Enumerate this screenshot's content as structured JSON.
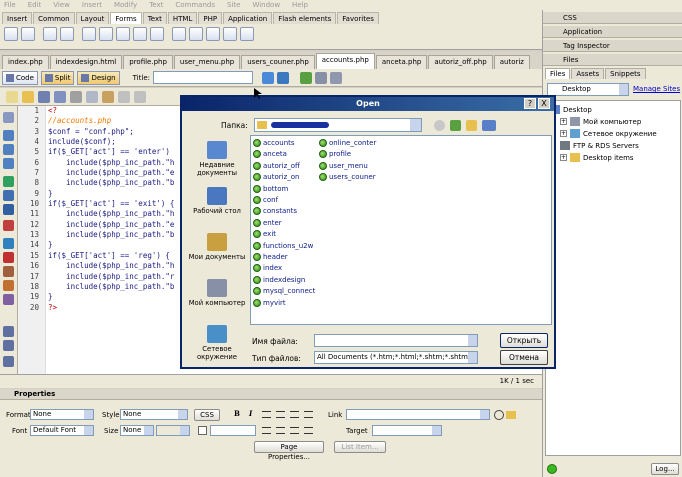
{
  "menubar": [
    "File",
    "Edit",
    "View",
    "Insert",
    "Modify",
    "Text",
    "Commands",
    "Site",
    "Window",
    "Help"
  ],
  "insert_tabs": [
    "Insert",
    "Common",
    "Layout",
    "Forms",
    "Text",
    "HTML",
    "PHP",
    "Application",
    "Flash elements",
    "Favorites"
  ],
  "insert_active": "Forms",
  "doc_tabs": [
    "index.php",
    "indexdesign.html",
    "profile.php",
    "user_menu.php",
    "users_couner.php",
    "accounts.php",
    "anceta.php",
    "autoriz_off.php",
    "autoriz"
  ],
  "doc_active": "accounts.php",
  "doc_toolbar": {
    "code": "Code",
    "split": "Split",
    "design": "Design",
    "title_label": "Title:"
  },
  "code": {
    "line_numbers": [
      "1",
      "2",
      "3",
      "4",
      "5",
      "6",
      "7",
      "8",
      "9",
      "10",
      "11",
      "12",
      "13",
      "14",
      "15",
      "16",
      "17",
      "18",
      "19",
      "20"
    ],
    "lines": [
      "<?",
      "//accounts.php",
      "$conf = \"conf.php\";",
      "include($conf);",
      "if($_GET['act'] == 'enter')",
      "    include($php_inc_path.\"h",
      "    include($php_inc_path.\"e",
      "    include($php_inc_path.\"b",
      "}",
      "if($_GET['act'] == 'exit') {",
      "    include($php_inc_path.\"h",
      "    include($php_inc_path.\"e",
      "    include($php_inc_path.\"b",
      "}",
      "if($_GET['act'] == 'reg') {",
      "    include($php_inc_path.\"h",
      "    include($php_inc_path.\"r",
      "    include($php_inc_path.\"b",
      "}",
      "?>"
    ]
  },
  "status": "1K / 1 sec",
  "properties": {
    "title": "Properties",
    "format_label": "Format",
    "format_value": "None",
    "style_label": "Style",
    "style_value": "None",
    "css_button": "CSS",
    "link_label": "Link",
    "font_label": "Font",
    "font_value": "Default Font",
    "size_label": "Size",
    "size_value": "None",
    "target_label": "Target",
    "page_properties": "Page Properties...",
    "list_item": "List Item..."
  },
  "right_panel": {
    "css": "CSS",
    "application": "Application",
    "tag_inspector": "Tag Inspector",
    "files": "Files",
    "tabs": [
      "Files",
      "Assets",
      "Snippets"
    ],
    "site_select": "Desktop",
    "manage_sites": "Manage Sites",
    "tree": [
      "Desktop",
      "Мой компьютер",
      "Сетевое окружение",
      "FTP & RDS Servers",
      "Desktop items"
    ],
    "log_button": "Log..."
  },
  "dialog": {
    "title": "Open",
    "lookin_label": "Папка:",
    "places": [
      "Недавние документы",
      "Рабочий стол",
      "Мои документы",
      "Мой компьютер",
      "Сетевое окружение"
    ],
    "files_col1": [
      "accounts",
      "anceta",
      "autoriz_off",
      "autoriz_on",
      "bottom",
      "conf",
      "constants",
      "enter",
      "exit",
      "functions_u2w",
      "header",
      "index",
      "indexdesign",
      "mysql_connect",
      "myvirt"
    ],
    "files_col2": [
      "online_conter",
      "profile",
      "user_menu",
      "users_couner"
    ],
    "filename_label": "Имя файла:",
    "filetype_label": "Тип файлов:",
    "filetype_value": "All Documents (*.htm;*.html;*.shtm;*.shtml;*.hta;",
    "open_button": "Открыть",
    "cancel_button": "Отмена",
    "help_button": "?",
    "close_button": "X"
  }
}
